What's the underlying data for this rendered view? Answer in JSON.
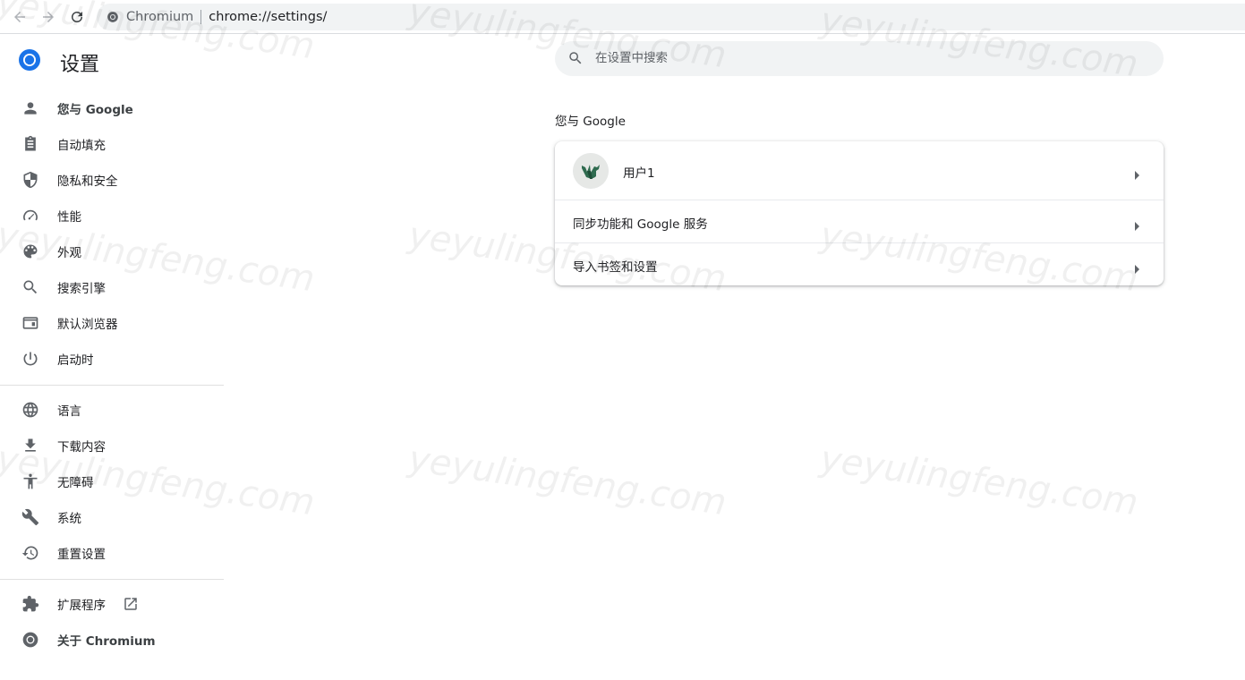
{
  "toolbar": {
    "site_name": "Chromium",
    "url": "chrome://settings/"
  },
  "page": {
    "title": "设置"
  },
  "search": {
    "placeholder": "在设置中搜索"
  },
  "sidebar": {
    "items": [
      {
        "label": "您与 Google",
        "icon": "person-icon",
        "selected": true
      },
      {
        "label": "自动填充",
        "icon": "clipboard-icon"
      },
      {
        "label": "隐私和安全",
        "icon": "shield-icon"
      },
      {
        "label": "性能",
        "icon": "speedometer-icon"
      },
      {
        "label": "外观",
        "icon": "palette-icon"
      },
      {
        "label": "搜索引擎",
        "icon": "search-icon"
      },
      {
        "label": "默认浏览器",
        "icon": "browser-window-icon"
      },
      {
        "label": "启动时",
        "icon": "power-icon"
      },
      {
        "label": "语言",
        "icon": "globe-icon"
      },
      {
        "label": "下载内容",
        "icon": "download-icon"
      },
      {
        "label": "无障碍",
        "icon": "accessibility-icon"
      },
      {
        "label": "系统",
        "icon": "wrench-icon"
      },
      {
        "label": "重置设置",
        "icon": "history-icon"
      },
      {
        "label": "扩展程序",
        "icon": "puzzle-icon"
      },
      {
        "label": "关于 Chromium",
        "icon": "chromium-icon"
      }
    ]
  },
  "main": {
    "section_title": "您与 Google",
    "rows": [
      {
        "label": "用户1"
      },
      {
        "label": "同步功能和 Google 服务"
      },
      {
        "label": "导入书签和设置"
      }
    ]
  },
  "watermark": "yeyulingfeng.com",
  "colors": {
    "accent": "#1a73e8",
    "icon": "#5f6368",
    "search_bg": "#f1f3f4"
  }
}
